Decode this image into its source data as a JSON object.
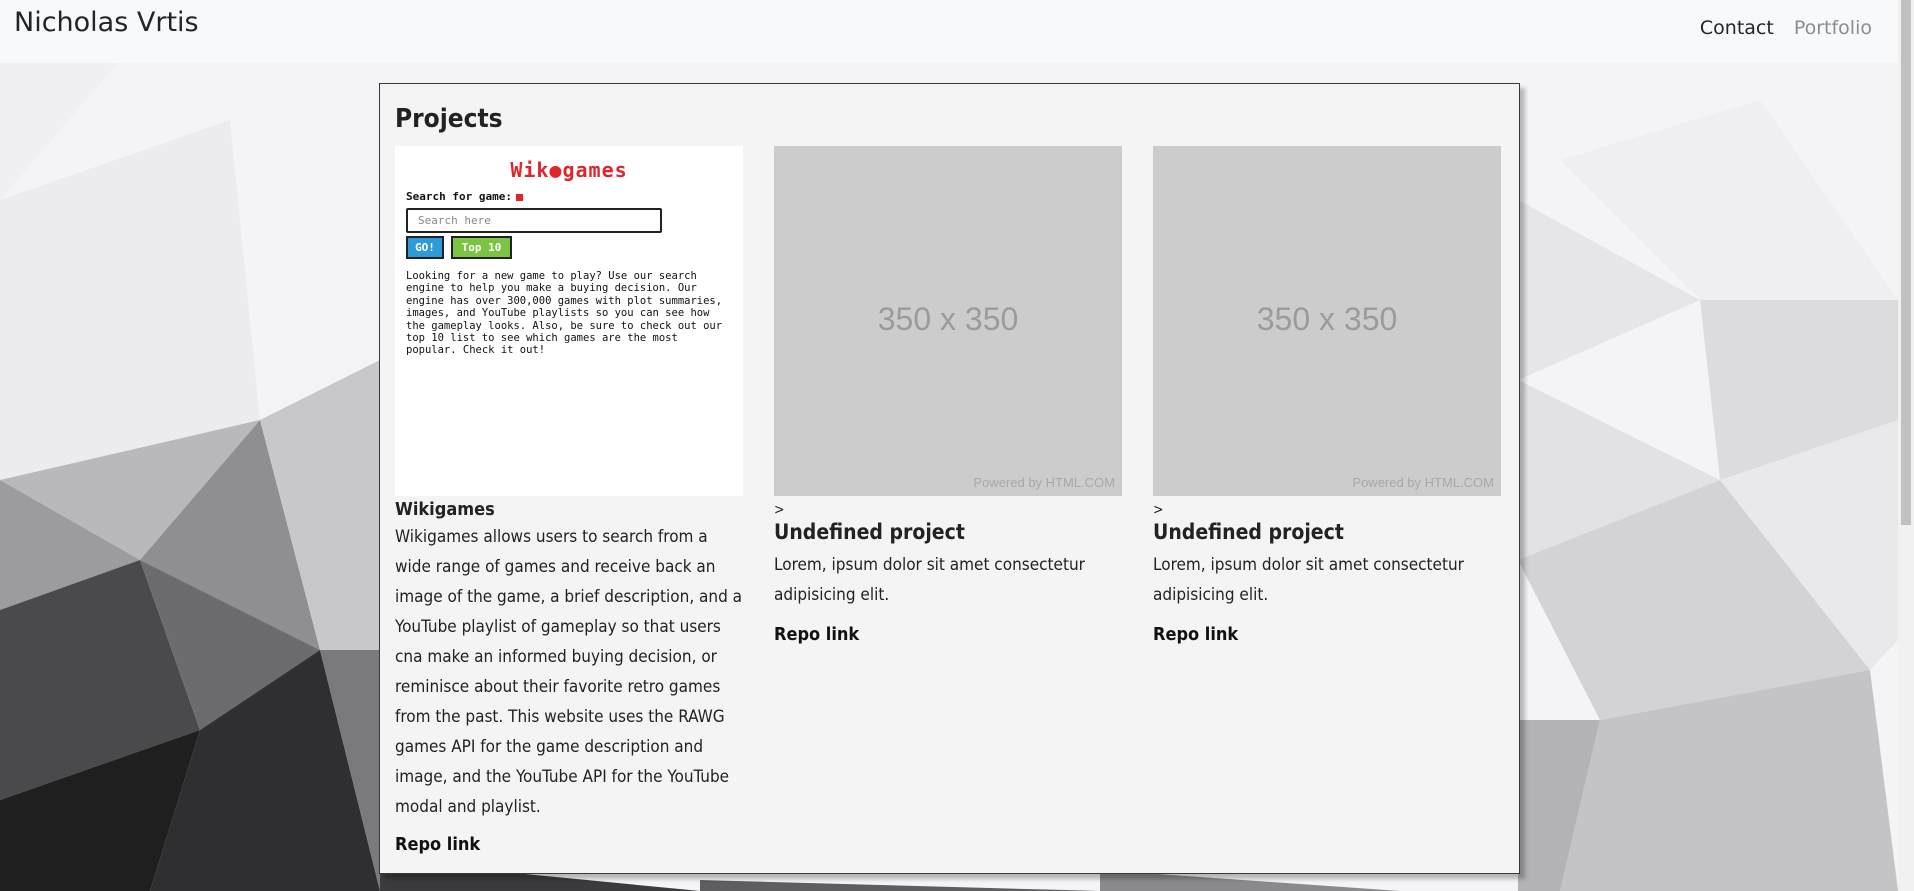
{
  "header": {
    "brand": "Nicholas Vrtis",
    "nav": [
      {
        "label": "Contact"
      },
      {
        "label": "Portfolio"
      }
    ]
  },
  "projects": {
    "title": "Projects",
    "featured": {
      "preview": {
        "logo": "Wik●games",
        "search_label": "Search for game:",
        "search_placeholder": "Search here",
        "go_button": "GO!",
        "top_button": "Top 10",
        "blurb": "Looking for a new game to play? Use our search engine to help you make a buying decision. Our engine has over 300,000 games with plot summaries, images, and YouTube playlists so you can see how the gameplay looks. Also, be sure to check out our top 10 list to see which games are the most popular. Check it out!"
      },
      "name": "Wikigames",
      "description": "Wikigames allows users to search from a wide range of games and receive back an image of the game, a brief description, and a YouTube playlist of gameplay so that users cna make an informed buying decision, or reminisce about their favorite retro games from the past. This website uses the RAWG games API for the game description and image, and the YouTube API for the YouTube modal and playlist.",
      "repo_link": "Repo link"
    },
    "placeholders": [
      {
        "image_text": "350 x 350",
        "powered_by": "Powered by HTML.COM",
        "marker": ">",
        "title": "Undefined project",
        "description": "Lorem, ipsum dolor sit amet consectetur adipisicing elit.",
        "repo_link": "Repo link"
      },
      {
        "image_text": "350 x 350",
        "powered_by": "Powered by HTML.COM",
        "marker": ">",
        "title": "Undefined project",
        "description": "Lorem, ipsum dolor sit amet consectetur adipisicing elit.",
        "repo_link": "Repo link"
      }
    ]
  },
  "colors": {
    "navbar_bg": "#f8f9fa",
    "panel_bg": "#f4f4f4",
    "placeholder_bg": "#cccccc",
    "wikigames_red": "#e0262b",
    "go_blue": "#2d9bd8",
    "top_green": "#7cc544"
  }
}
